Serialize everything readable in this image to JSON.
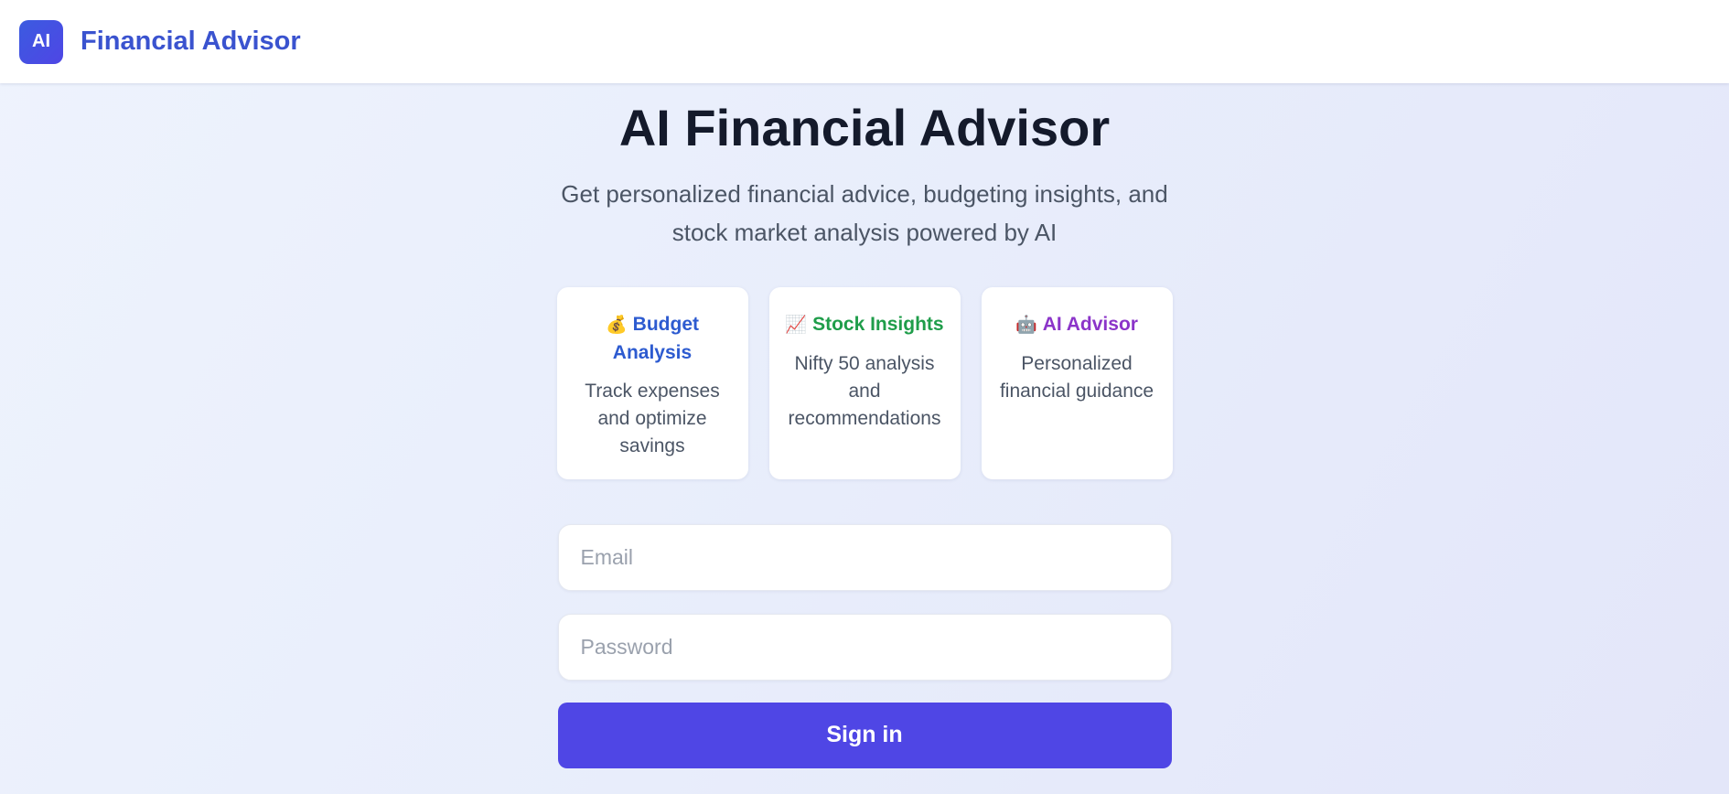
{
  "header": {
    "logo_text": "AI",
    "brand_name": "Financial Advisor"
  },
  "hero": {
    "title": "AI Financial Advisor",
    "subtitle": "Get personalized financial advice, budgeting insights, and stock market analysis powered by AI"
  },
  "features": [
    {
      "icon": "money-bag-icon",
      "emoji": "💰",
      "title": "Budget Analysis",
      "description": "Track expenses and optimize savings",
      "color": "#2d5bd0"
    },
    {
      "icon": "chart-increasing-icon",
      "emoji": "📈",
      "title": "Stock Insights",
      "description": "Nifty 50 analysis and recommendations",
      "color": "#1f9d4a"
    },
    {
      "icon": "robot-icon",
      "emoji": "🤖",
      "title": "AI Advisor",
      "description": "Personalized financial guidance",
      "color": "#8b34c9"
    }
  ],
  "form": {
    "email_placeholder": "Email",
    "password_placeholder": "Password",
    "submit_label": "Sign in"
  },
  "colors": {
    "brand": "#3a53cf",
    "accent": "#4f46e5"
  }
}
